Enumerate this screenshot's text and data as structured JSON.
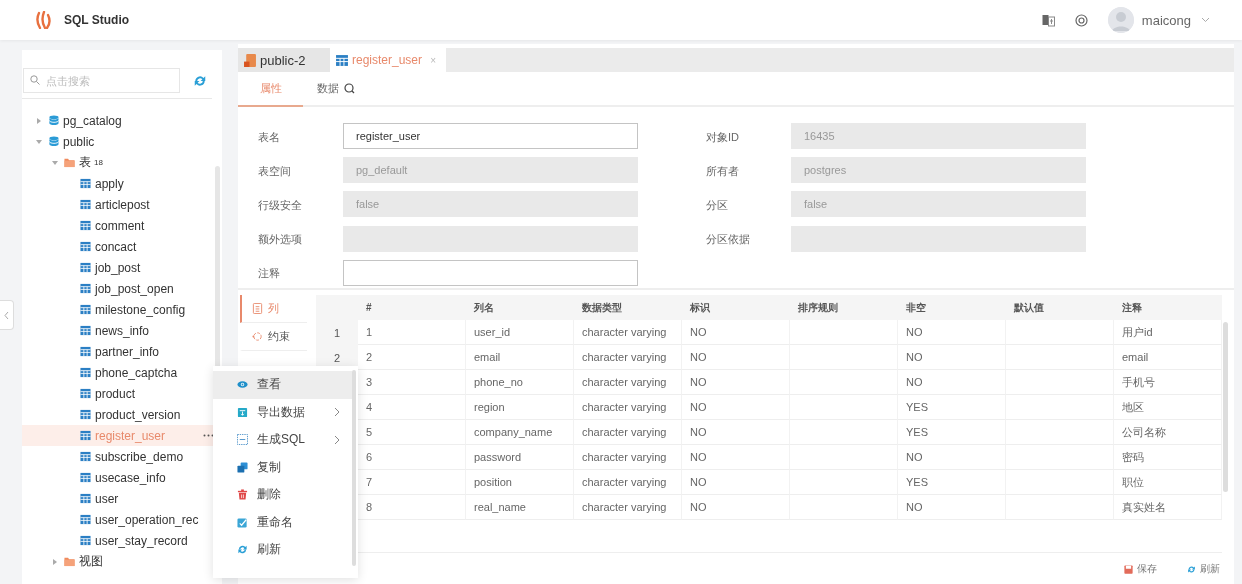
{
  "app": {
    "title": "SQL Studio",
    "user": "maicong"
  },
  "sidebar": {
    "search": {
      "placeholder": "点击搜索"
    },
    "tree": [
      {
        "label": "pg_catalog",
        "kind": "schema",
        "expanded": false,
        "selected": false
      },
      {
        "label": "public",
        "kind": "schema",
        "expanded": true,
        "selected": false,
        "children": [
          {
            "label": "表",
            "count": "18",
            "kind": "folder",
            "expanded": true,
            "selected": false,
            "children": [
              {
                "label": "apply",
                "kind": "table",
                "selected": false
              },
              {
                "label": "articlepost",
                "kind": "table",
                "selected": false
              },
              {
                "label": "comment",
                "kind": "table",
                "selected": false
              },
              {
                "label": "concact",
                "kind": "table",
                "selected": false
              },
              {
                "label": "job_post",
                "kind": "table",
                "selected": false
              },
              {
                "label": "job_post_open",
                "kind": "table",
                "selected": false
              },
              {
                "label": "milestone_config",
                "kind": "table",
                "selected": false
              },
              {
                "label": "news_info",
                "kind": "table",
                "selected": false
              },
              {
                "label": "partner_info",
                "kind": "table",
                "selected": false
              },
              {
                "label": "phone_captcha",
                "kind": "table",
                "selected": false
              },
              {
                "label": "product",
                "kind": "table",
                "selected": false
              },
              {
                "label": "product_version",
                "kind": "table",
                "selected": false
              },
              {
                "label": "register_user",
                "kind": "table",
                "selected": true
              },
              {
                "label": "subscribe_demo",
                "kind": "table",
                "selected": false
              },
              {
                "label": "usecase_info",
                "kind": "table",
                "selected": false
              },
              {
                "label": "user",
                "kind": "table",
                "selected": false
              },
              {
                "label": "user_operation_rec",
                "kind": "table",
                "selected": false
              },
              {
                "label": "user_stay_record",
                "kind": "table",
                "selected": false
              }
            ]
          },
          {
            "label": "视图",
            "kind": "folder",
            "expanded": false,
            "selected": false
          }
        ]
      }
    ]
  },
  "tabs": [
    {
      "label": "public-2",
      "kind": "database",
      "selected": false
    },
    {
      "label": "register_user",
      "kind": "table",
      "selected": true,
      "close": "×"
    }
  ],
  "subtabs": [
    {
      "label": "属性",
      "selected": true
    },
    {
      "label": "数据",
      "selected": false,
      "search": true
    }
  ],
  "form": {
    "left": [
      {
        "label": "表名",
        "value": "register_user",
        "disabled": false
      },
      {
        "label": "表空间",
        "value": "pg_default",
        "disabled": true
      },
      {
        "label": "行级安全",
        "value": "false",
        "disabled": true
      },
      {
        "label": "额外选项",
        "disabled": true
      },
      {
        "label": "注释",
        "disabled": false
      }
    ],
    "right": [
      {
        "label": "对象ID",
        "value": "16435",
        "disabled": true
      },
      {
        "label": "所有者",
        "value": "postgres",
        "disabled": true
      },
      {
        "label": "分区",
        "value": "false",
        "disabled": true
      },
      {
        "label": "分区依据",
        "disabled": true
      }
    ]
  },
  "side_tabs": [
    {
      "label": "列",
      "kind": "columns",
      "selected": true
    },
    {
      "label": "约束",
      "kind": "constraint",
      "selected": false
    }
  ],
  "table": {
    "columns": [
      "#",
      "列名",
      "数据类型",
      "标识",
      "排序规则",
      "非空",
      "默认值",
      "注释"
    ],
    "rows": [
      {
        "row_number": "1",
        "cells": [
          "1",
          "user_id",
          "character varying",
          "NO",
          "",
          "NO",
          "",
          "用户id"
        ]
      },
      {
        "row_number": "2",
        "cells": [
          "2",
          "email",
          "character varying",
          "NO",
          "",
          "NO",
          "",
          "email"
        ]
      },
      {
        "cells": [
          "3",
          "phone_no",
          "character varying",
          "NO",
          "",
          "NO",
          "",
          "手机号"
        ]
      },
      {
        "cells": [
          "4",
          "region",
          "character varying",
          "NO",
          "",
          "YES",
          "",
          "地区"
        ]
      },
      {
        "cells": [
          "5",
          "company_name",
          "character varying",
          "NO",
          "",
          "YES",
          "",
          "公司名称"
        ]
      },
      {
        "cells": [
          "6",
          "password",
          "character varying",
          "NO",
          "",
          "NO",
          "",
          "密码"
        ]
      },
      {
        "cells": [
          "7",
          "position",
          "character varying",
          "NO",
          "",
          "YES",
          "",
          "职位"
        ]
      },
      {
        "cells": [
          "8",
          "real_name",
          "character varying",
          "NO",
          "",
          "NO",
          "",
          "真实姓名"
        ]
      }
    ]
  },
  "footer_buttons": [
    {
      "label": "保存",
      "kind": "save"
    },
    {
      "label": "刷新",
      "kind": "refresh"
    }
  ],
  "context_menu": [
    {
      "label": "查看",
      "kind": "view",
      "selected": true,
      "submenu": false
    },
    {
      "label": "导出数据",
      "kind": "export",
      "selected": false,
      "submenu": true
    },
    {
      "label": "生成SQL",
      "kind": "sql",
      "selected": false,
      "submenu": true
    },
    {
      "label": "复制",
      "kind": "copy",
      "selected": false,
      "submenu": false
    },
    {
      "label": "删除",
      "kind": "delete",
      "selected": false,
      "submenu": false
    },
    {
      "label": "重命名",
      "kind": "rename",
      "selected": false,
      "submenu": false
    },
    {
      "label": "刷新",
      "kind": "refresh",
      "selected": false,
      "submenu": false
    }
  ]
}
